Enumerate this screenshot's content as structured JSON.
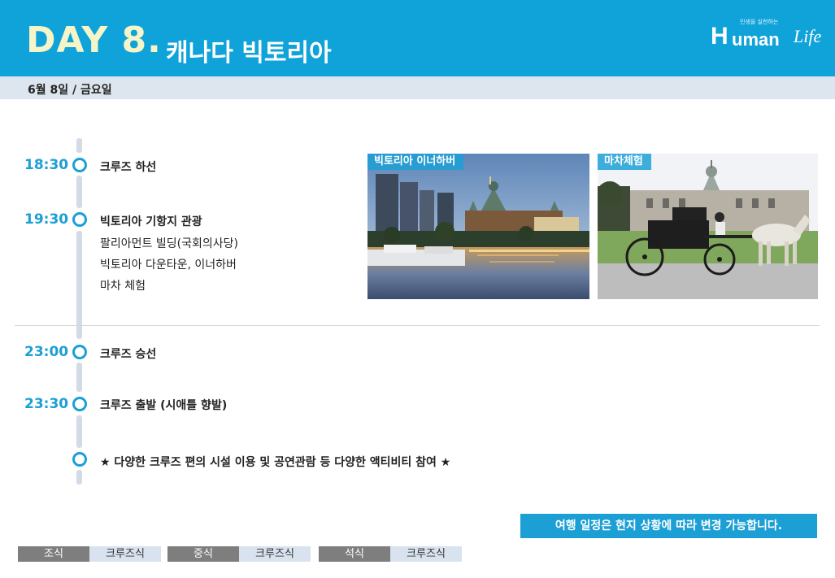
{
  "header": {
    "day": "DAY 8.",
    "place": "캐나다 빅토리아",
    "logo": {
      "tagline": "인생을 실천하는",
      "h": "H",
      "uman": "uman",
      "life": "Life"
    }
  },
  "date": "6월 8일 / 금요일",
  "schedule": [
    {
      "time": "18:30",
      "text": "크루즈 하선"
    },
    {
      "time": "19:30",
      "text": "빅토리아 기항지 관광",
      "details": [
        "팔리아먼트 빌딩(국회의사당)",
        "빅토리아 다운타운, 이너하버",
        "마차 체험"
      ]
    },
    {
      "time": "23:00",
      "text": "크루즈 승선"
    },
    {
      "time": "23:30",
      "text": "크루즈 출발 (시애틀 향발)"
    },
    {
      "time": "",
      "text": "★ 다양한 크루즈 편의 시설 이용 및 공연관람 등 다양한 액티비티 참여 ★"
    }
  ],
  "photos": [
    {
      "label": "빅토리아 이너하버"
    },
    {
      "label": "마차체험"
    }
  ],
  "notice": "여행 일정은 현지 상황에 따라 변경 가능합니다.",
  "meals": [
    {
      "type": "조식",
      "value": "크루즈식"
    },
    {
      "type": "중식",
      "value": "크루즈식"
    },
    {
      "type": "석식",
      "value": "크루즈식"
    }
  ],
  "colors": {
    "accent": "#1c9fd4",
    "header": "#0fa3d9",
    "dayText": "#f6f5c8"
  }
}
